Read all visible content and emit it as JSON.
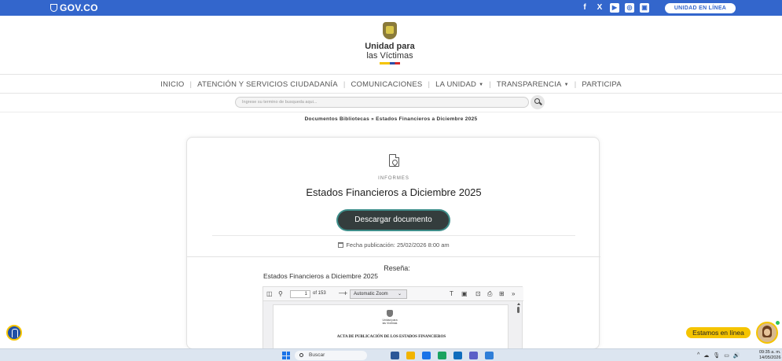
{
  "topbar": {
    "gov_label": "GOV.CO",
    "socials": [
      "f",
      "X",
      "▶",
      "◎",
      "▣"
    ],
    "unidad_en_linea": "UNIDAD EN LÍNEA"
  },
  "brand": {
    "line1": "Unidad para",
    "line2": "las Víctimas"
  },
  "nav": {
    "items": [
      {
        "label": "INICIO"
      },
      {
        "label": "ATENCIÓN Y SERVICIOS CIUDADANÍA"
      },
      {
        "label": "COMUNICACIONES"
      },
      {
        "label": "LA UNIDAD",
        "dropdown": true
      },
      {
        "label": "TRANSPARENCIA",
        "dropdown": true
      },
      {
        "label": "PARTICIPA"
      }
    ]
  },
  "search": {
    "placeholder": "Ingrese su termino de busqueda aqui..."
  },
  "breadcrumb": "Documentos Bibliotecas » Estados Financieros a Diciembre 2025",
  "document": {
    "category": "INFORMES",
    "title": "Estados Financieros a Diciembre 2025",
    "download_label": "Descargar documento",
    "pub_date": "Fecha publicación: 25/02/2026 8:00 am",
    "resena_label": "Reseña:",
    "resena_text": "Estados Financieros a Diciembre 2025"
  },
  "viewer": {
    "page_number": "1",
    "page_count": "of 153",
    "minus": "—",
    "plus": "+",
    "zoom": "Automatic Zoom",
    "zoom_caret": "⌄",
    "page_org_line1": "Unidad para",
    "page_org_line2": "las Víctimas",
    "page_heading": "ACTA DE PUBLICACIÓN DE LOS ESTADOS FINANCIEROS"
  },
  "chat": {
    "label": "Estamos en línea"
  },
  "taskbar": {
    "search_label": "Buscar",
    "tray_caret": "^",
    "clock_time": "09:35 a. m.",
    "clock_date": "14/05/2026",
    "app_colors": [
      "#2b5797",
      "#f2b400",
      "#1a73e8",
      "#1aa260",
      "#0f6cbd",
      "#5b5fc7",
      "#2f7ed8"
    ]
  },
  "colors": {
    "gov_blue": "#3366cc",
    "button_dark": "#343d3d",
    "accent_yellow": "#f5c400"
  }
}
